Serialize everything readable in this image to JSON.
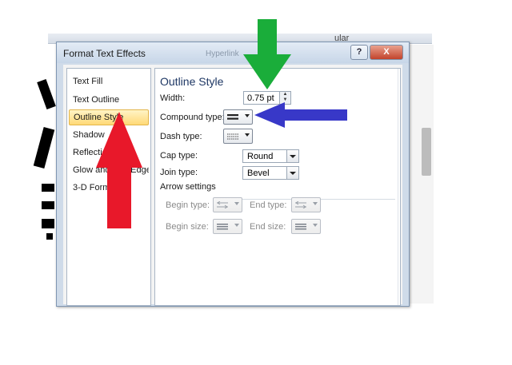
{
  "dialog": {
    "title": "Format Text Effects",
    "ghost_title_fragment": "Hyperlink",
    "help_label": "?",
    "close_label": "X"
  },
  "background": {
    "ribbon_text": "ular"
  },
  "nav": {
    "items": [
      {
        "label": "Text Fill"
      },
      {
        "label": "Text Outline"
      },
      {
        "label": "Outline Style"
      },
      {
        "label": "Shadow"
      },
      {
        "label": "Reflection"
      },
      {
        "label": "Glow and Soft Edges"
      },
      {
        "label": "3-D Format"
      }
    ],
    "selected_index": 2
  },
  "panel": {
    "section_title": "Outline Style",
    "width": {
      "label": "Width:",
      "value": "0.75 pt"
    },
    "compound_type": {
      "label": "Compound type:"
    },
    "dash_type": {
      "label": "Dash type:"
    },
    "cap_type": {
      "label": "Cap type:",
      "value": "Round"
    },
    "join_type": {
      "label": "Join type:",
      "value": "Bevel"
    },
    "arrow_settings": {
      "label": "Arrow settings",
      "begin_type": "Begin type:",
      "end_type": "End type:",
      "begin_size": "Begin size:",
      "end_size": "End size:"
    }
  },
  "annotations": {
    "green_arrow_color": "#1aad3a",
    "blue_arrow_color": "#3838c8",
    "red_arrow_color": "#e8182a",
    "selected_item_highlight": "#ffd977"
  }
}
